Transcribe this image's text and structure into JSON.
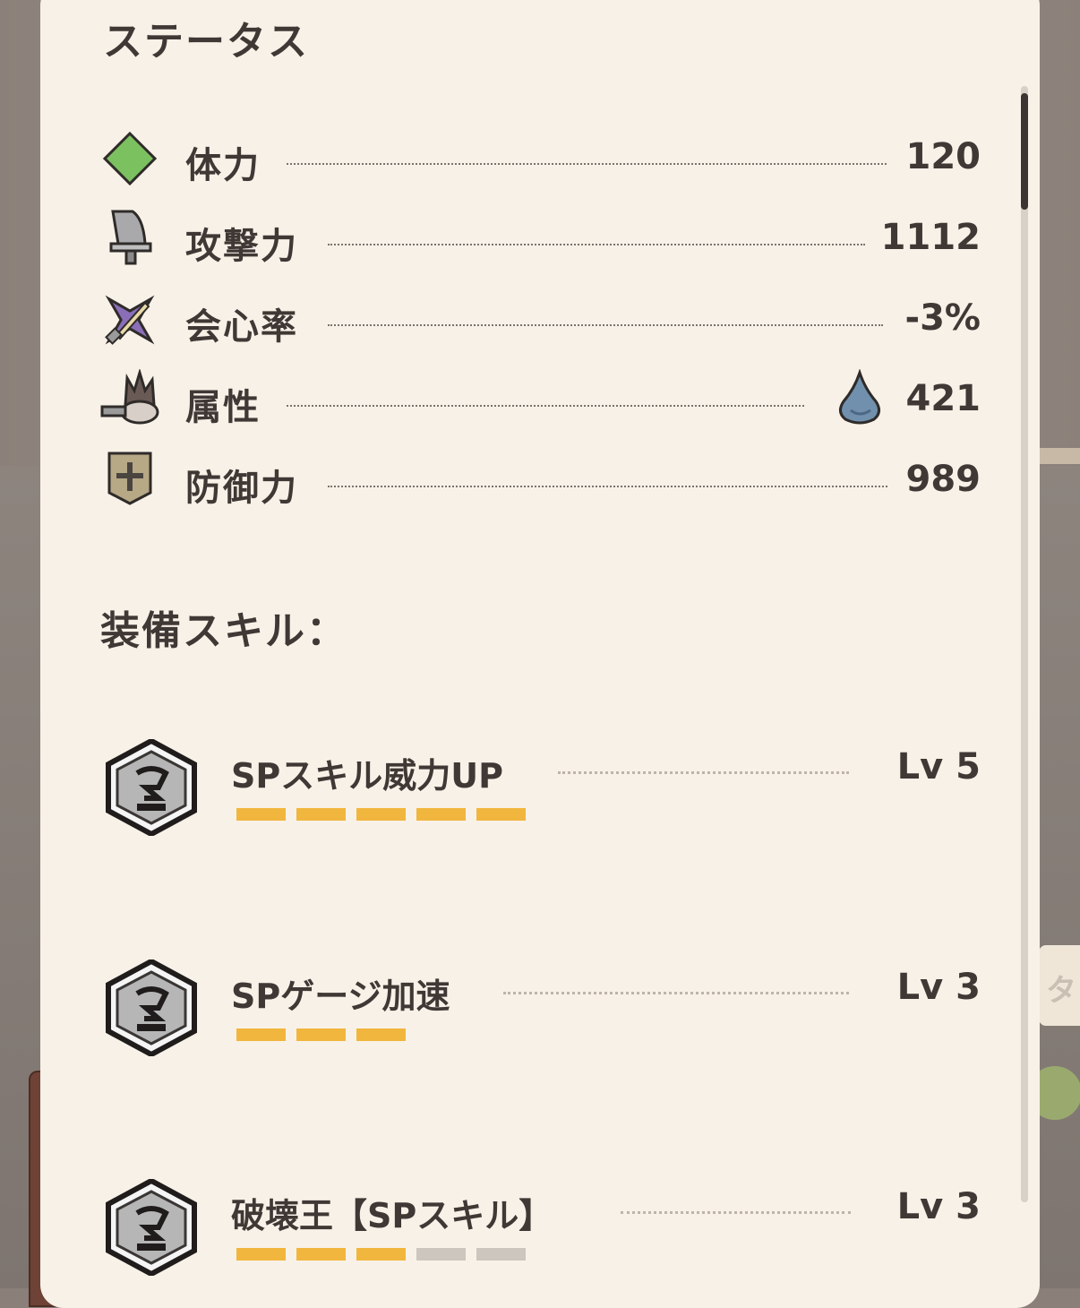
{
  "title": "ステータス",
  "stats": [
    {
      "label": "体力",
      "value": "120",
      "icon": "diamond-icon"
    },
    {
      "label": "攻撃力",
      "value": "1112",
      "icon": "sword-icon"
    },
    {
      "label": "会心率",
      "value": "-3%",
      "icon": "crit-icon"
    },
    {
      "label": "属性",
      "value": "421",
      "icon": "fire-element-icon",
      "element_icon": "water-drop-icon"
    },
    {
      "label": "防御力",
      "value": "989",
      "icon": "shield-icon"
    }
  ],
  "skills_title": "装備スキル：",
  "skills": [
    {
      "name": "SPスキル威力UP",
      "level": "Lv 5",
      "level_num": 5,
      "max_level": 5,
      "icon": "skill-hex-icon"
    },
    {
      "name": "SPゲージ加速",
      "level": "Lv 3",
      "level_num": 3,
      "max_level": 3,
      "icon": "skill-hex-icon"
    },
    {
      "name": "破壊王【SPスキル】",
      "level": "Lv 3",
      "level_num": 3,
      "max_level": 5,
      "icon": "skill-hex-icon"
    }
  ],
  "background_tab_text": "タ",
  "colors": {
    "panel": "#f8f1e8",
    "text": "#3f3835",
    "pip_on": "#f1b63d",
    "pip_off": "#ccc6bf",
    "diamond": "#7cc160",
    "water": "#7090ad"
  }
}
